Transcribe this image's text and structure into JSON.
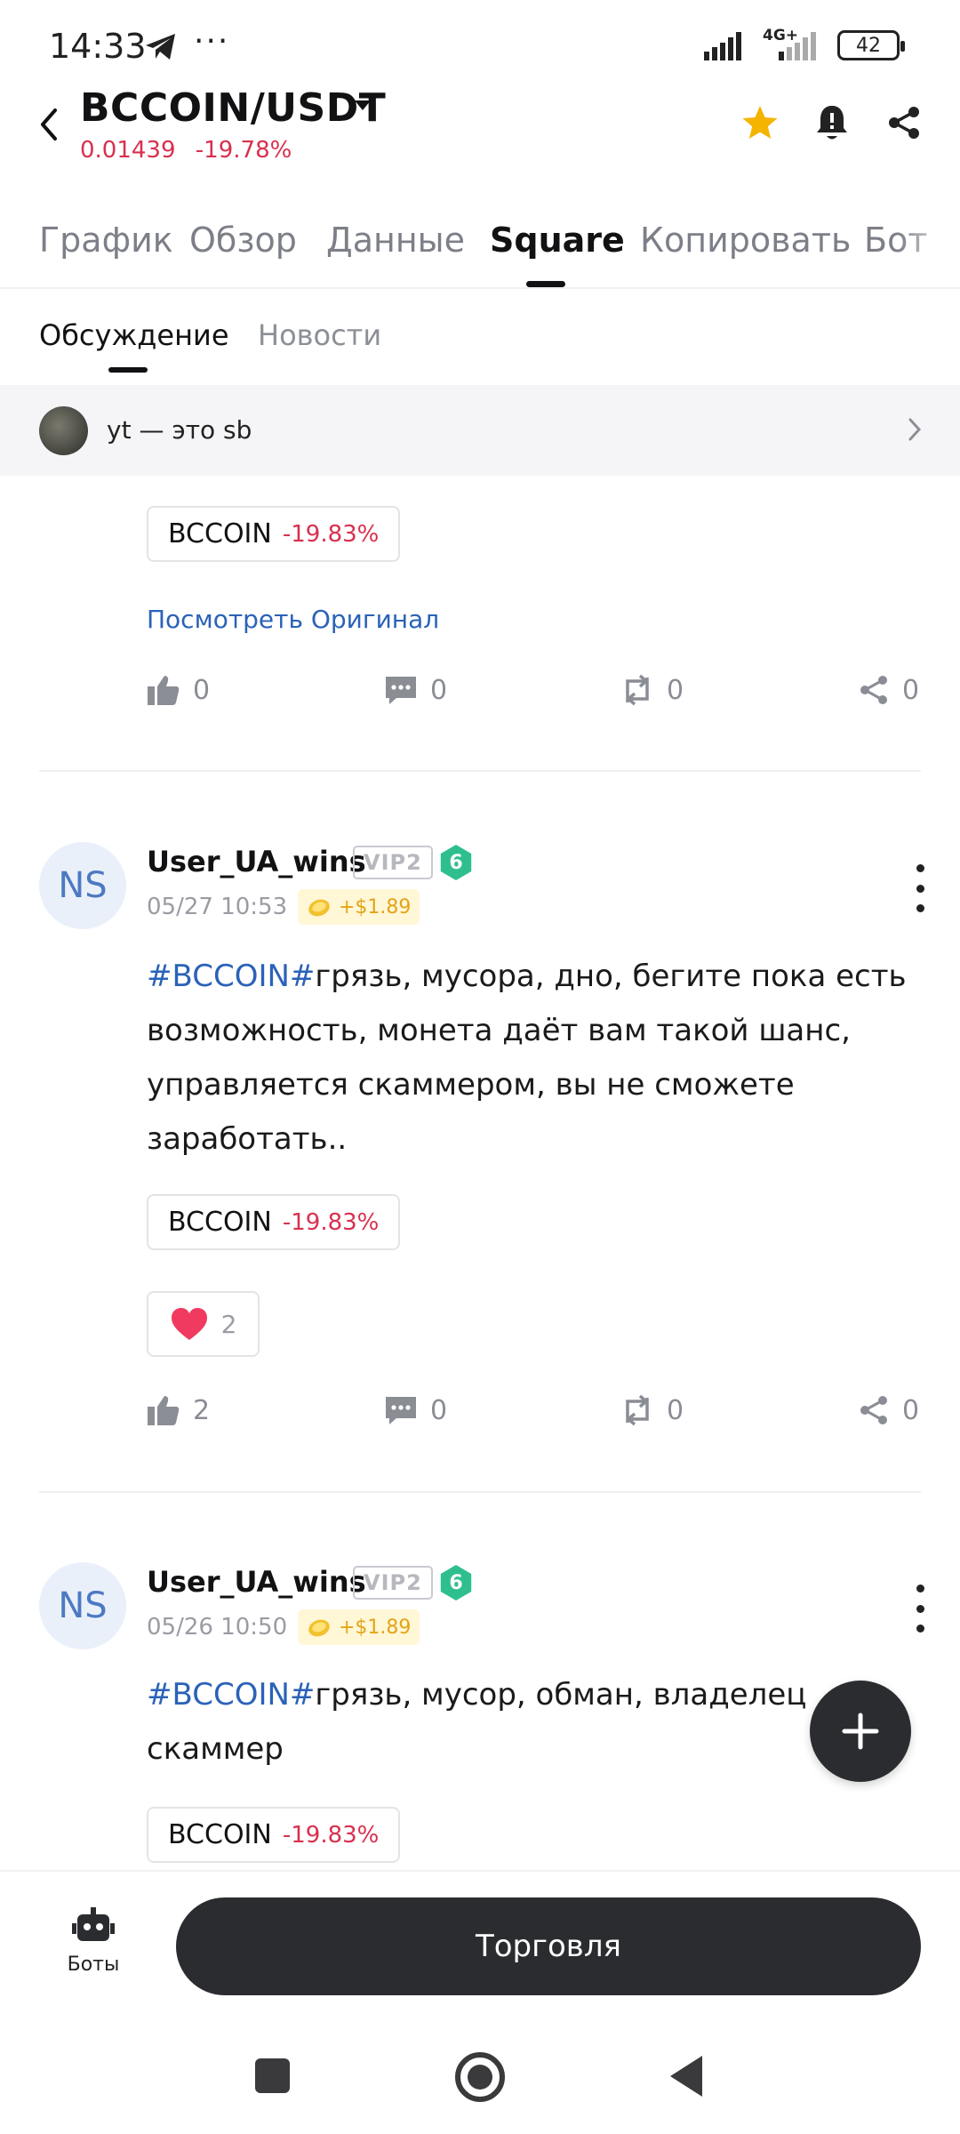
{
  "status_bar": {
    "time": "14:33",
    "dots": "···",
    "network": "4G+",
    "battery": "42"
  },
  "header": {
    "pair": "BCCOIN/USDT",
    "price": "0.01439",
    "change": "-19.78%"
  },
  "main_tabs": [
    "График",
    "Обзор",
    "Данные",
    "Square",
    "Копировать",
    "Бот"
  ],
  "sub_tabs": [
    "Обсуждение",
    "Новости"
  ],
  "pinned": {
    "text": "yt — это sb"
  },
  "colors": {
    "negative": "#d9304f",
    "link": "#2a62b8",
    "dark_button": "#2b2c30"
  },
  "post0": {
    "ticker": "BCCOIN",
    "ticker_change": "-19.83%",
    "view_original": "Посмотреть Оригинал",
    "likes": "0",
    "comments": "0",
    "reposts": "0",
    "shares": "0"
  },
  "post1": {
    "avatar": "NS",
    "user": "User_UA_wins",
    "vip": "VIP2",
    "level": "6",
    "date": "05/27 10:53",
    "tip": "+$1.89",
    "hashtag": "#BCCOIN#",
    "text": "грязь, мусора, дно, бегите пока есть возможность, монета даёт вам такой шанс, управляется скаммером, вы не сможете заработать..",
    "ticker": "BCCOIN",
    "ticker_change": "-19.83%",
    "reaction_count": "2",
    "likes": "2",
    "comments": "0",
    "reposts": "0",
    "shares": "0"
  },
  "post2": {
    "avatar": "NS",
    "user": "User_UA_wins",
    "vip": "VIP2",
    "level": "6",
    "date": "05/26 10:50",
    "tip": "+$1.89",
    "hashtag": "#BCCOIN#",
    "text": "грязь, мусор, обман, владелец скаммер",
    "ticker": "BCCOIN",
    "ticker_change": "-19.83%"
  },
  "bottom": {
    "bots_label": "Боты",
    "trade_label": "Торговля"
  }
}
